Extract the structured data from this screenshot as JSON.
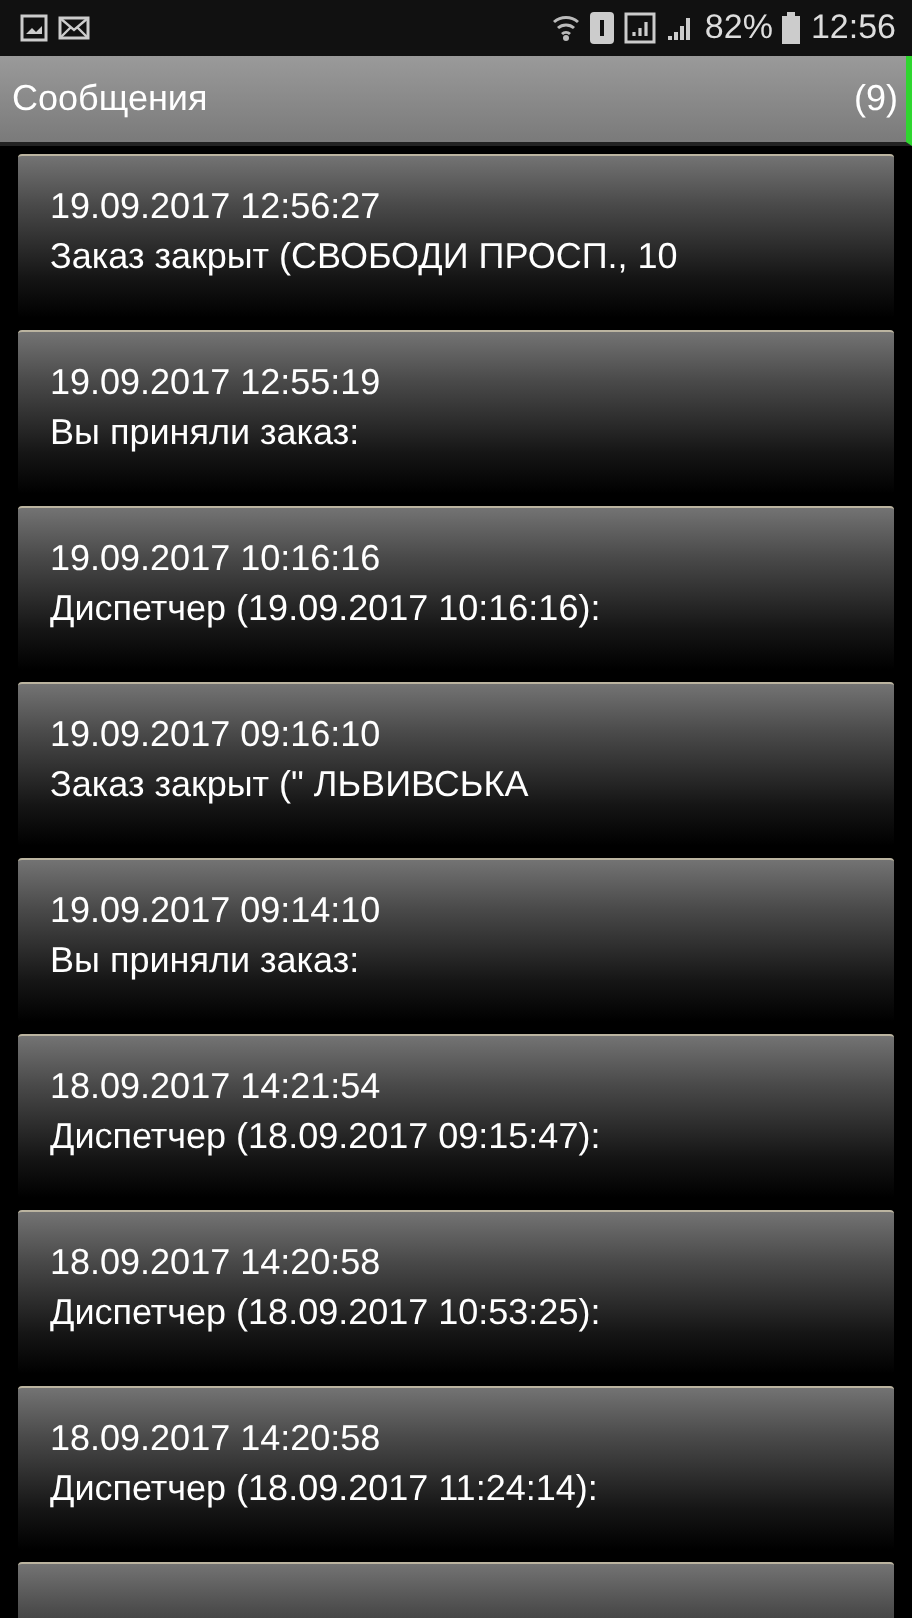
{
  "status_bar": {
    "battery": "82%",
    "time": "12:56"
  },
  "header": {
    "title": "Сообщения",
    "count": "(9)"
  },
  "messages": [
    {
      "date": "19.09.2017 12:56:27",
      "text": "Заказ закрыт (СВОБОДИ ПРОСП., 10"
    },
    {
      "date": "19.09.2017 12:55:19",
      "text": "Вы приняли заказ:"
    },
    {
      "date": "19.09.2017 10:16:16",
      "text": "Диспетчер (19.09.2017 10:16:16):"
    },
    {
      "date": "19.09.2017 09:16:10",
      "text": "Заказ закрыт (\" ЛЬВИВСЬКА"
    },
    {
      "date": "19.09.2017 09:14:10",
      "text": "Вы приняли заказ:"
    },
    {
      "date": "18.09.2017 14:21:54",
      "text": "Диспетчер (18.09.2017 09:15:47):"
    },
    {
      "date": "18.09.2017 14:20:58",
      "text": "Диспетчер (18.09.2017 10:53:25):"
    },
    {
      "date": "18.09.2017 14:20:58",
      "text": "Диспетчер (18.09.2017 11:24:14):"
    }
  ],
  "more_below": true
}
